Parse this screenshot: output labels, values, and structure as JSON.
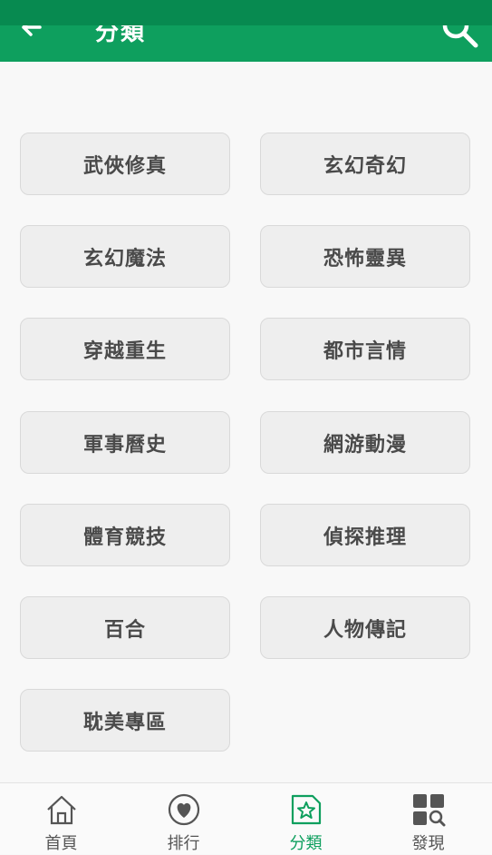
{
  "app_bar": {
    "title": "分類",
    "back_icon": "arrow-left-icon",
    "search_icon": "search-icon",
    "color": "#0e9f5e",
    "status_color": "#078a50"
  },
  "categories": [
    "武俠修真",
    "玄幻奇幻",
    "玄幻魔法",
    "恐怖靈異",
    "穿越重生",
    "都市言情",
    "軍事曆史",
    "網游動漫",
    "體育競技",
    "偵探推理",
    "百合",
    "人物傳記",
    "耽美專區"
  ],
  "bottom_nav": {
    "items": [
      {
        "label": "首頁",
        "icon": "home-icon",
        "active": false
      },
      {
        "label": "排行",
        "icon": "heart-icon",
        "active": false
      },
      {
        "label": "分類",
        "icon": "star-category-icon",
        "active": true
      },
      {
        "label": "發現",
        "icon": "grid-search-icon",
        "active": false
      }
    ],
    "active_color": "#0e9f5e",
    "inactive_color": "#555555"
  }
}
